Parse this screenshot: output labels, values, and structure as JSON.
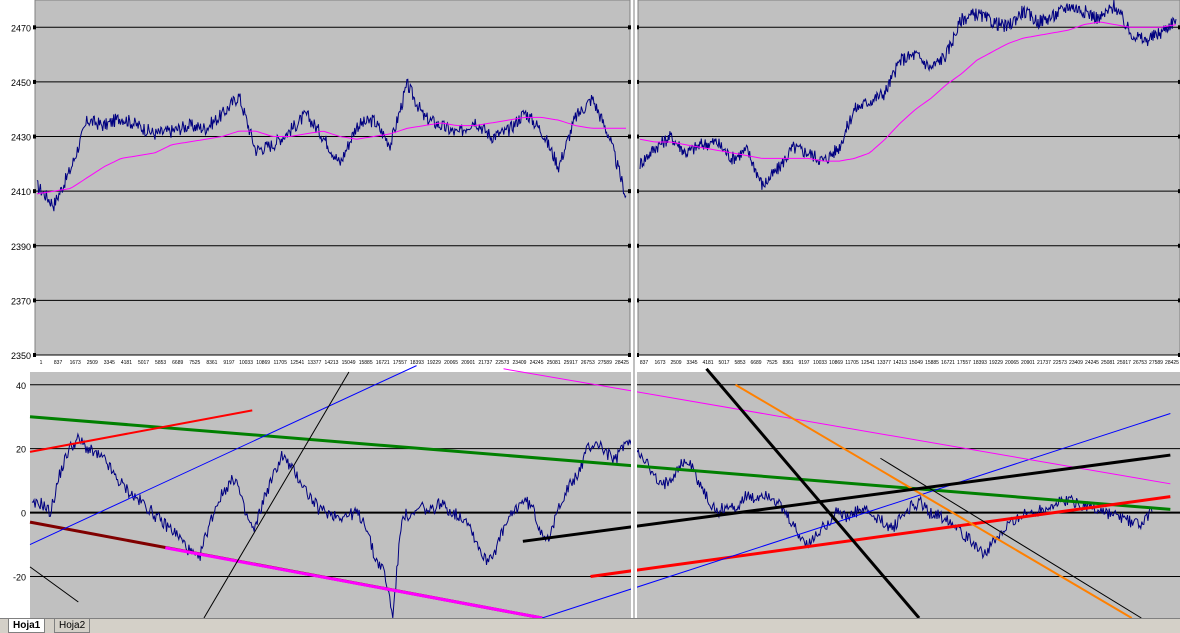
{
  "sheet_tabs": [
    {
      "label": "Hoja1",
      "active": true
    },
    {
      "label": "Hoja2",
      "active": false
    }
  ],
  "colors": {
    "background": "#c0c0c0",
    "price_series": "#000080",
    "moving_average": "#ff00ff",
    "grid": "#000000"
  },
  "chart_data": [
    {
      "type": "line",
      "panel": "top-left",
      "title": "",
      "xlabel": "",
      "ylabel": "",
      "ylim": [
        2350,
        2480
      ],
      "yticks": [
        2350,
        2370,
        2390,
        2410,
        2430,
        2450,
        2470
      ],
      "xticks": [
        "1",
        "837",
        "1673",
        "2509",
        "3345",
        "4181",
        "5017",
        "5853",
        "6689",
        "7525",
        "8361",
        "9197",
        "10033",
        "10869",
        "11705",
        "12541",
        "13377",
        "14213",
        "15049",
        "15885",
        "16721",
        "17557",
        "18393",
        "19229",
        "20065",
        "20901",
        "21737",
        "22573",
        "23409",
        "24245",
        "25081",
        "25917",
        "26753",
        "27589",
        "28425"
      ],
      "x": [
        1,
        837,
        1673,
        2509,
        3345,
        4181,
        5017,
        5853,
        6689,
        7525,
        8361,
        9197,
        10033,
        10869,
        11705,
        12541,
        13377,
        14213,
        15049,
        15885,
        16721,
        17557,
        18393,
        19229,
        20065,
        20901,
        21737,
        22573,
        23409,
        24245,
        25081,
        25917,
        26753,
        27589,
        28425,
        29000
      ],
      "series": [
        {
          "values": [
            2412,
            2405,
            2418,
            2436,
            2434,
            2437,
            2434,
            2431,
            2432,
            2434,
            2433,
            2438,
            2445,
            2425,
            2427,
            2432,
            2438,
            2430,
            2420,
            2434,
            2436,
            2427,
            2449,
            2437,
            2434,
            2431,
            2436,
            2430,
            2432,
            2439,
            2432,
            2419,
            2437,
            2444,
            2430,
            2408
          ]
        },
        {
          "values": [
            2409,
            2410,
            2411,
            2415,
            2419,
            2422,
            2423,
            2424,
            2427,
            2428,
            2429,
            2430,
            2432,
            2432,
            2430,
            2430,
            2431,
            2432,
            2430,
            2429,
            2430,
            2431,
            2433,
            2434,
            2435,
            2434,
            2434,
            2435,
            2436,
            2437,
            2437,
            2436,
            2434,
            2433,
            2433,
            2433
          ]
        }
      ]
    },
    {
      "type": "line",
      "panel": "top-right",
      "title": "",
      "xlabel": "",
      "ylabel": "",
      "ylim": [
        2350,
        2480
      ],
      "yticks": [
        2350,
        2370,
        2390,
        2410,
        2430,
        2450,
        2470
      ],
      "xticks": [
        "837",
        "1673",
        "2509",
        "3345",
        "4181",
        "5017",
        "5853",
        "6689",
        "7525",
        "8361",
        "9197",
        "10033",
        "10869",
        "11705",
        "12541",
        "13377",
        "14213",
        "15049",
        "15885",
        "16721",
        "17557",
        "18393",
        "19229",
        "20065",
        "20901",
        "21737",
        "22573",
        "23409",
        "24245",
        "25081",
        "25917",
        "26753",
        "27589",
        "28425"
      ],
      "x": [
        0,
        837,
        1673,
        2509,
        3345,
        4181,
        5017,
        5853,
        6689,
        7525,
        8361,
        9197,
        10033,
        10869,
        11705,
        12541,
        13377,
        14213,
        15049,
        15885,
        16721,
        17557,
        18393,
        19229,
        20065,
        20901,
        21737,
        22573,
        23409,
        24245,
        25081,
        25917,
        26753,
        27589,
        28425,
        29000
      ],
      "series": [
        {
          "values": [
            2420,
            2426,
            2430,
            2424,
            2427,
            2428,
            2422,
            2425,
            2412,
            2418,
            2426,
            2424,
            2421,
            2426,
            2440,
            2443,
            2446,
            2458,
            2460,
            2455,
            2460,
            2473,
            2475,
            2472,
            2470,
            2476,
            2472,
            2474,
            2478,
            2476,
            2473,
            2478,
            2468,
            2465,
            2468,
            2473
          ]
        },
        {
          "values": [
            2429,
            2428,
            2428,
            2427,
            2426,
            2425,
            2424,
            2423,
            2422,
            2422,
            2422,
            2422,
            2421,
            2421,
            2422,
            2424,
            2429,
            2435,
            2440,
            2444,
            2449,
            2453,
            2458,
            2461,
            2464,
            2466,
            2467,
            2468,
            2469,
            2471,
            2472,
            2471,
            2470,
            2470,
            2470,
            2471
          ]
        }
      ]
    },
    {
      "type": "line",
      "panel": "bottom",
      "title": "",
      "xlabel": "",
      "ylabel": "",
      "ylim": [
        -33,
        44
      ],
      "yticks": [
        -20,
        0,
        20,
        40
      ],
      "x_panels": [
        [
          0,
          59
        ],
        [
          60,
          119
        ]
      ],
      "series": [
        {
          "values": [
            2,
            3,
            0,
            12,
            20,
            23,
            20,
            18,
            16,
            11,
            8,
            5,
            3,
            0,
            -3,
            -5,
            -8,
            -12,
            -15,
            -5,
            3,
            8,
            11,
            0,
            -6,
            4,
            11,
            18,
            14,
            10,
            5,
            1,
            0,
            -1,
            -1,
            0,
            -3,
            -14,
            -18,
            -32,
            0,
            -2,
            2,
            0,
            3,
            1,
            -1,
            -2,
            -9,
            -15,
            -12,
            -5,
            0,
            4,
            2,
            -6,
            -8,
            3,
            8,
            12,
            20,
            22,
            19,
            16,
            22,
            21,
            18,
            12,
            8,
            11,
            15,
            16,
            10,
            4,
            0,
            2,
            1,
            5,
            4,
            6,
            5,
            1,
            -3,
            -8,
            -10,
            -6,
            -3,
            1,
            -2,
            0,
            1,
            -2,
            -3,
            -5,
            -1,
            2,
            3,
            0,
            -1,
            -2,
            -4,
            -8,
            -10,
            -13,
            -9,
            -6,
            -2,
            -1,
            0,
            1,
            2,
            3,
            4,
            3,
            2,
            1,
            0,
            -1,
            -2,
            -3,
            -4,
            2
          ],
          "x_start": 1,
          "x_end": 118
        },
        {
          "name": "",
          "values": [],
          "x_start": 0,
          "x_end": 0
        }
      ],
      "trendlines": [
        {
          "color": "#008000",
          "width": 3,
          "from": [
            0,
            30
          ],
          "to": [
            118,
            1
          ]
        },
        {
          "color": "#ff0000",
          "width": 2,
          "from": [
            0,
            19
          ],
          "to": [
            23,
            32
          ]
        },
        {
          "color": "#ff0000",
          "width": 3,
          "from": [
            58,
            -20
          ],
          "to": [
            118,
            5
          ]
        },
        {
          "color": "#800000",
          "width": 3,
          "from": [
            0,
            -3
          ],
          "to": [
            53,
            -33
          ]
        },
        {
          "color": "#ff00ff",
          "width": 3,
          "from": [
            14,
            -11
          ],
          "to": [
            53,
            -33
          ]
        },
        {
          "color": "#0000ff",
          "width": 1,
          "from": [
            0,
            -10
          ],
          "to": [
            40,
            46
          ]
        },
        {
          "color": "#0000ff",
          "width": 1,
          "from": [
            53,
            -33
          ],
          "to": [
            118,
            31
          ]
        },
        {
          "color": "#000000",
          "width": 1,
          "from": [
            18,
            -33
          ],
          "to": [
            33,
            44
          ]
        },
        {
          "color": "#000000",
          "width": 1,
          "from": [
            0,
            -17
          ],
          "to": [
            5,
            -28
          ]
        },
        {
          "color": "#ff00ff",
          "width": 1,
          "from": [
            49,
            45
          ],
          "to": [
            118,
            9
          ]
        },
        {
          "color": "#000000",
          "width": 3,
          "from": [
            70,
            45
          ],
          "to": [
            92,
            -33
          ]
        },
        {
          "color": "#ff8000",
          "width": 2,
          "from": [
            73,
            40
          ],
          "to": [
            114,
            -33
          ]
        },
        {
          "color": "#000000",
          "width": 3,
          "from": [
            51,
            -9
          ],
          "to": [
            118,
            18
          ]
        },
        {
          "color": "#000000",
          "width": 1,
          "from": [
            88,
            17
          ],
          "to": [
            115,
            -33
          ]
        }
      ]
    }
  ]
}
